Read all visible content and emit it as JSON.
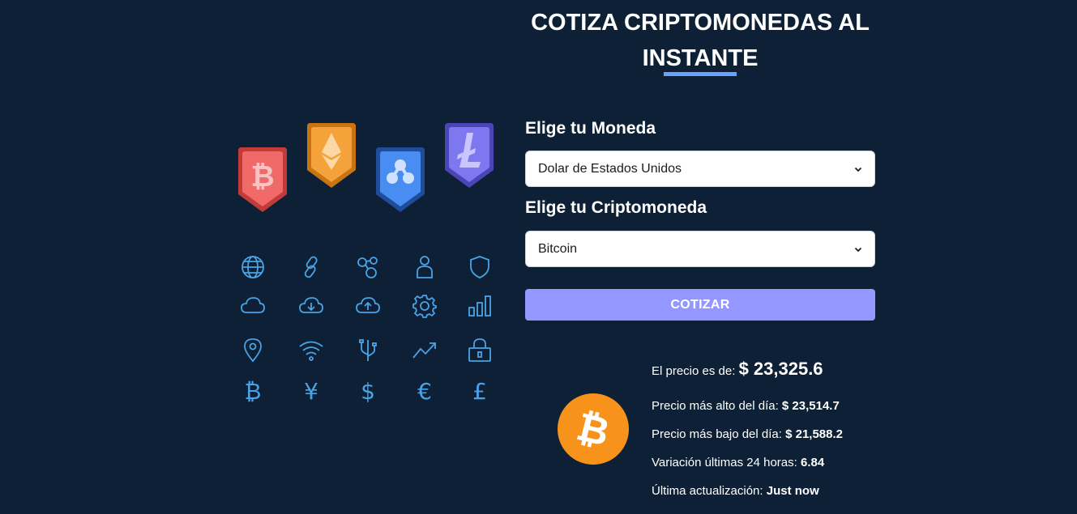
{
  "header": {
    "title": "COTIZA CRIPTOMONEDAS AL INSTANTE"
  },
  "form": {
    "currency_label": "Elige tu Moneda",
    "currency_value": "Dolar de Estados Unidos",
    "crypto_label": "Elige tu Criptomoneda",
    "crypto_value": "Bitcoin",
    "submit_label": "COTIZAR"
  },
  "result": {
    "price_label": "El precio es de:",
    "price_value": "$ 23,325.6",
    "high_label": "Precio más alto del día:",
    "high_value": "$ 23,514.7",
    "low_label": "Precio más bajo del día:",
    "low_value": "$ 21,588.2",
    "change_label": "Variación últimas 24 horas:",
    "change_value": "6.84",
    "updated_label": "Última actualización:",
    "updated_value": "Just now"
  },
  "illustration": {
    "badges": [
      "bitcoin-badge-icon",
      "ethereum-badge-icon",
      "ripple-badge-icon",
      "litecoin-badge-icon"
    ],
    "glyphs": {
      "bitcoin": "₿",
      "yen": "¥",
      "dollar": "$",
      "euro": "€",
      "pound": "£"
    }
  },
  "colors": {
    "background": "#0d2035",
    "accent": "#66a2fe",
    "button": "#9497ff",
    "coin": "#f7931a",
    "icon": "#4aa3e6"
  }
}
